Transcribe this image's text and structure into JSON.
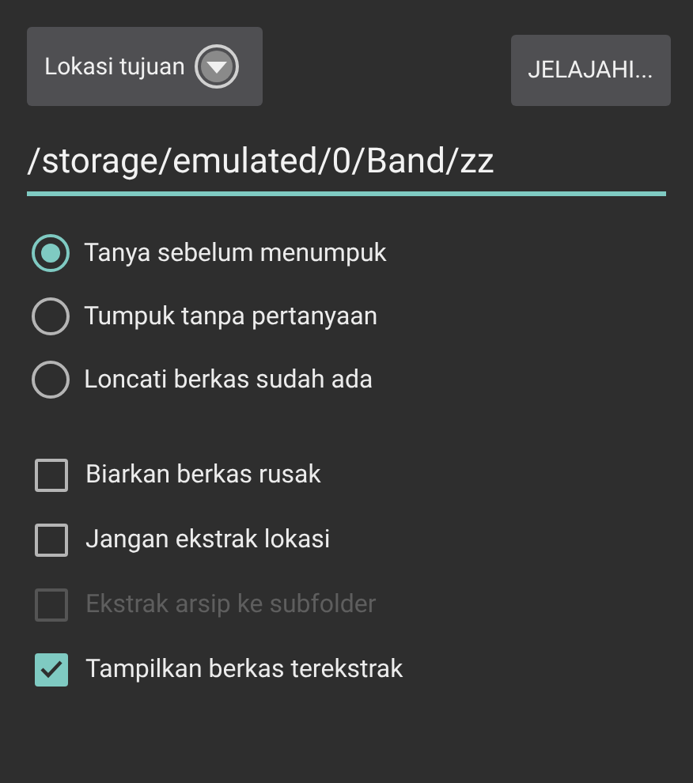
{
  "destination_button": {
    "label": "Lokasi tujuan"
  },
  "browse_button": {
    "label": "JELAJAHI..."
  },
  "path_field": {
    "value": "/storage/emulated/0/Band/zz"
  },
  "overwrite_options": [
    {
      "label": "Tanya sebelum menumpuk",
      "selected": true
    },
    {
      "label": "Tumpuk tanpa pertanyaan",
      "selected": false
    },
    {
      "label": "Loncati berkas sudah ada",
      "selected": false
    }
  ],
  "checkboxes": [
    {
      "label": "Biarkan berkas rusak",
      "checked": false,
      "disabled": false
    },
    {
      "label": "Jangan ekstrak lokasi",
      "checked": false,
      "disabled": false
    },
    {
      "label": "Ekstrak arsip ke subfolder",
      "checked": false,
      "disabled": true
    },
    {
      "label": "Tampilkan berkas terekstrak",
      "checked": true,
      "disabled": false
    }
  ]
}
